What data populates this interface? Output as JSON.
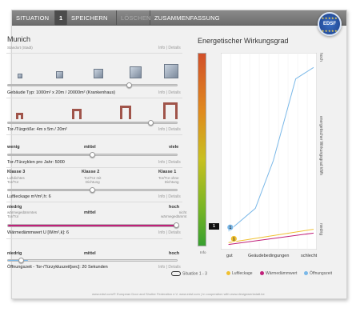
{
  "nav": {
    "tabs": [
      {
        "label": "SITUATION"
      },
      {
        "label": "1"
      },
      {
        "label": "SPEICHERN"
      },
      {
        "label": "LÖSCHEN"
      },
      {
        "label": "ZUSAMMENFASSUNG"
      }
    ],
    "logo": "EDSF"
  },
  "location": {
    "city": "Munich",
    "hint": "Standort (Stadt)",
    "info": "Info | Details"
  },
  "building": {
    "label": "Gebäude Typ: 1000m² x 20m / 20000m² (Krankenhaus)",
    "info": "Info | Details",
    "value": 0.72
  },
  "door": {
    "label": "Tor-/Türgröße: 4m x 5m / 20m²",
    "info": "Info | Details",
    "value": 0.85
  },
  "cycles": {
    "low": "wenig",
    "mid": "mittel",
    "high": "viele",
    "label": "Tor-/Türzyklen pro Jahr: 5000",
    "info": "Info | Details",
    "value": 0.5
  },
  "leakage": {
    "classes": [
      {
        "name": "Klasse 3",
        "desc": "Luftdichtes\nTor/Tür"
      },
      {
        "name": "Klasse 2",
        "desc": "Tor/Tür mit\nDichtung"
      },
      {
        "name": "Klasse 1",
        "desc": "Tor/Tür ohne\nDichtung"
      }
    ],
    "label": "Luftleckage m³/m²,h: 6",
    "info": "Info | Details",
    "value": 0.5
  },
  "thermal": {
    "low": "niedrig",
    "low_desc": "wärmegedämmtes\nTor/Tür",
    "mid": "mittel",
    "high": "hoch",
    "high_desc": "nicht\nwärmegedämmt",
    "label": "Wärmedämmwert U [W/m²,k]: 6",
    "info": "Info | Details",
    "value": 1.0
  },
  "opening": {
    "low": "niedrig",
    "mid": "mittel",
    "high": "hoch",
    "label": "Öffnungszeit - Tor-/Türzykluszeit[sec]: 20 Sekunden",
    "info": "Info | Details",
    "value": 0.05
  },
  "gauge": {
    "title": "Energetischer Wirkungsgrad",
    "info": "Info",
    "marker": "1"
  },
  "chart_data": {
    "type": "line",
    "x": [
      "gut",
      "Geäudebedingungen",
      "schlecht"
    ],
    "xlabel_left": "gut",
    "xlabel_mid": "Geäudebedingungen",
    "xlabel_right": "schlecht",
    "ylabel": "energetischer Wirkungsgrad kWh",
    "y_high": "hoch",
    "y_low": "niedrig",
    "series": [
      {
        "name": "Luftleckage",
        "color": "#f0c030",
        "points": [
          [
            0.05,
            0.02
          ],
          [
            1.0,
            0.09
          ]
        ]
      },
      {
        "name": "Wärmedämmwert",
        "color": "#c0207a",
        "points": [
          [
            0.05,
            0.01
          ],
          [
            1.0,
            0.07
          ]
        ]
      },
      {
        "name": "Öffnungszeit",
        "color": "#7ab8e8",
        "points": [
          [
            0.05,
            0.08
          ],
          [
            0.35,
            0.2
          ],
          [
            0.55,
            0.45
          ],
          [
            0.8,
            0.88
          ],
          [
            1.0,
            0.94
          ]
        ]
      }
    ],
    "badges": [
      {
        "label": "1",
        "color": "#7ab8e8"
      },
      {
        "label": "1",
        "color": "#f0c030"
      }
    ]
  },
  "legend": {
    "situation": "Situation 1 - 3",
    "items": [
      {
        "label": "Luftleckage",
        "color": "#f0c030"
      },
      {
        "label": "Wärmedämmwert",
        "color": "#c0207a"
      },
      {
        "label": "Öffnungszeit",
        "color": "#7ab8e8"
      }
    ]
  },
  "footer": "www.edsf.com/© European Door and Shutter Federation e.V. www.edsf.com  |  In cooperation with www.designwerkstatt.be"
}
